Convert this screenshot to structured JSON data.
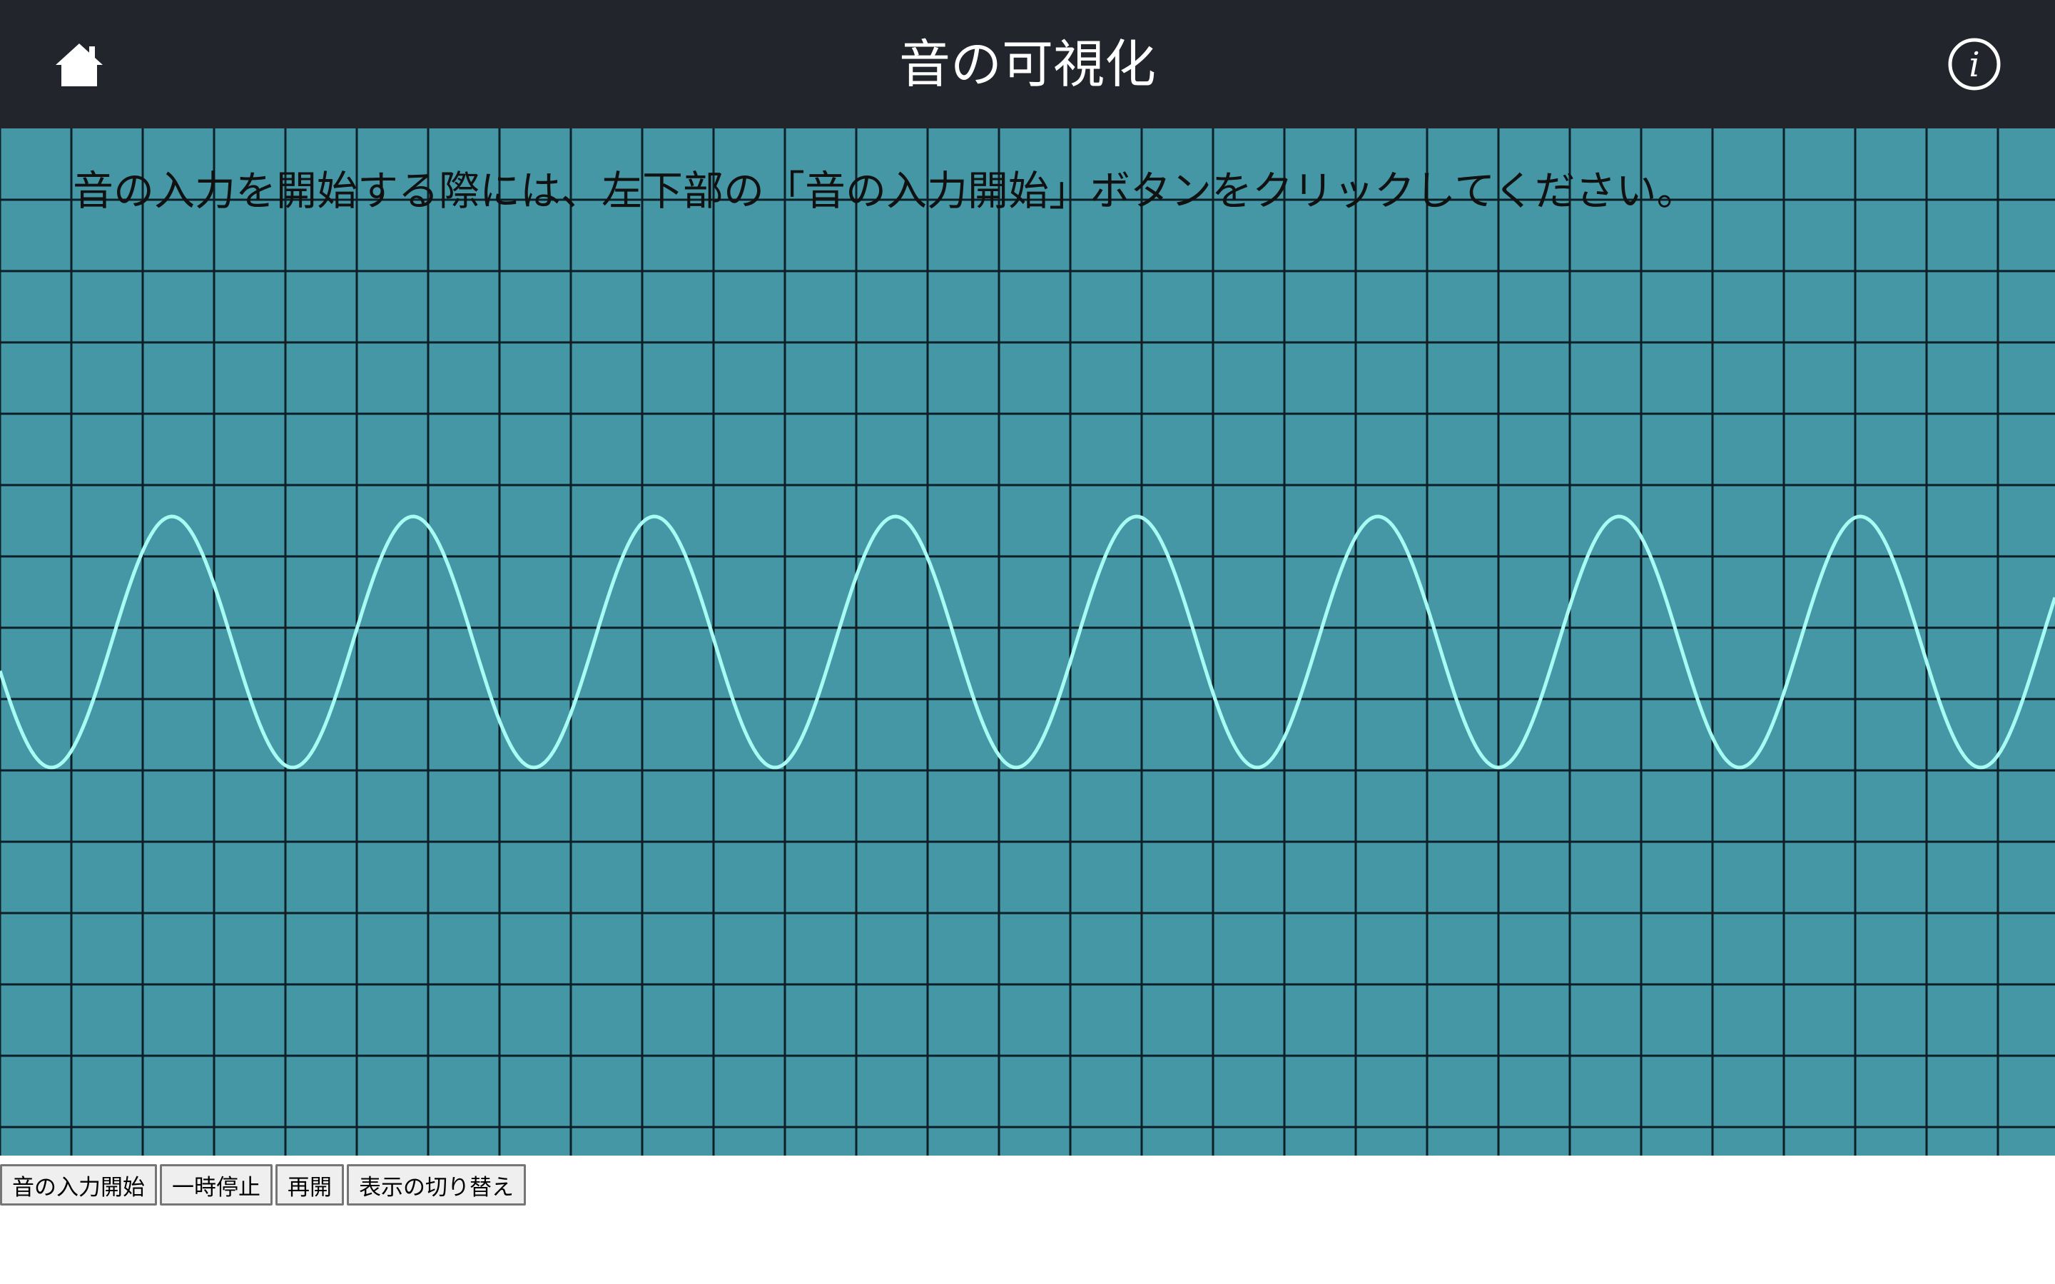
{
  "header": {
    "title": "音の可視化",
    "home_icon": "home-icon",
    "info_icon": "info-icon"
  },
  "main": {
    "instruction": "音の入力を開始する際には、左下部の「音の入力開始」ボタンをクリックしてください。"
  },
  "controls": {
    "start_label": "音の入力開始",
    "pause_label": "一時停止",
    "resume_label": "再開",
    "toggle_label": "表示の切り替え"
  },
  "colors": {
    "header_bg": "#22252b",
    "stage_bg": "#4697a6",
    "grid_line": "#0b1f26",
    "wave": "#a8fbf2"
  }
}
